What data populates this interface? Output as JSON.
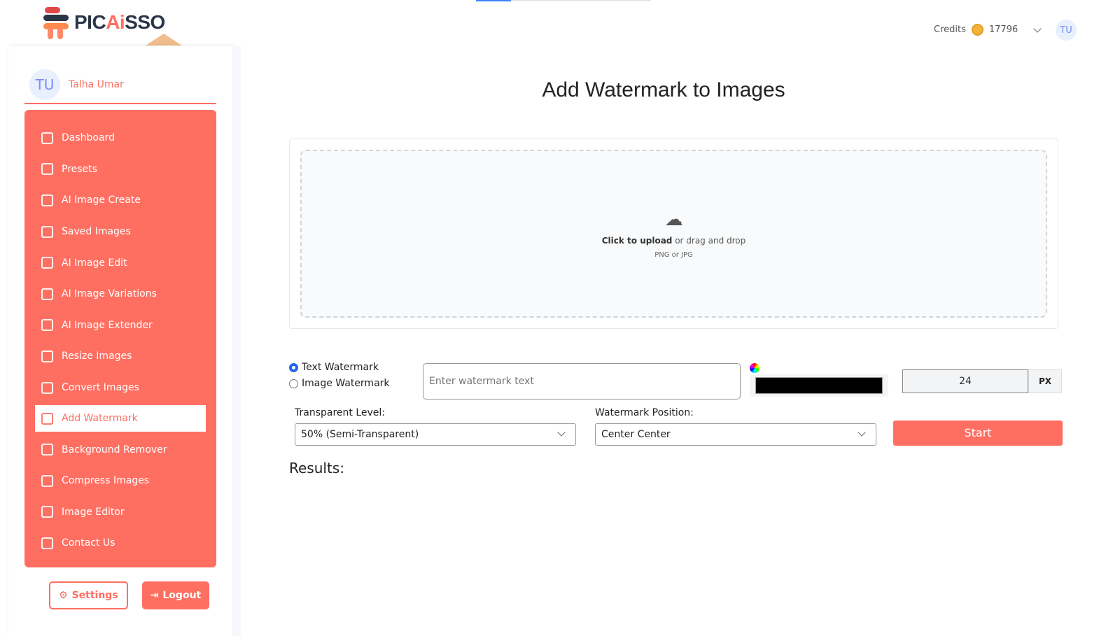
{
  "brand": {
    "name_prefix": "PIC",
    "name_ai": "Ai",
    "name_suffix": "SSO",
    "accent": "#ff6f61"
  },
  "header": {
    "credits_label": "Credits",
    "credits_value": "17796",
    "avatar_initials": "TU"
  },
  "sidebar": {
    "user_initials": "TU",
    "user_name": "Talha Umar",
    "items": [
      {
        "label": "Dashboard",
        "icon": "dashboard-icon"
      },
      {
        "label": "Presets",
        "icon": "presets-icon"
      },
      {
        "label": "AI Image Create",
        "icon": "image-create-icon"
      },
      {
        "label": "Saved Images",
        "icon": "saved-images-icon"
      },
      {
        "label": "AI Image Edit",
        "icon": "edit-icon"
      },
      {
        "label": "AI Image Variations",
        "icon": "variations-icon"
      },
      {
        "label": "AI Image Extender",
        "icon": "extender-icon"
      },
      {
        "label": "Resize Images",
        "icon": "resize-icon"
      },
      {
        "label": "Convert Images",
        "icon": "convert-icon"
      },
      {
        "label": "Add Watermark",
        "icon": "watermark-icon",
        "active": true
      },
      {
        "label": "Background Remover",
        "icon": "background-remover-icon"
      },
      {
        "label": "Compress Images",
        "icon": "compress-icon"
      },
      {
        "label": "Image Editor",
        "icon": "image-editor-icon"
      },
      {
        "label": "Contact Us",
        "icon": "contact-icon"
      }
    ],
    "settings_label": "Settings",
    "logout_label": "Logout"
  },
  "main": {
    "title": "Add Watermark to Images",
    "upload": {
      "click_text": "Click to upload",
      "rest_text": " or drag and drop",
      "formats": "PNG or JPG"
    },
    "radio_text": "Text Watermark",
    "radio_image": "Image Watermark",
    "radio_selected": "Text Watermark",
    "watermark_placeholder": "Enter watermark text",
    "watermark_value": "",
    "color": "#000000",
    "font_size": "24",
    "unit": "PX",
    "transparent_label": "Transparent Level:",
    "transparent_value": "50% (Semi-Transparent)",
    "position_label": "Watermark Position:",
    "position_value": "Center Center",
    "start_label": "Start",
    "results_label": "Results:"
  }
}
